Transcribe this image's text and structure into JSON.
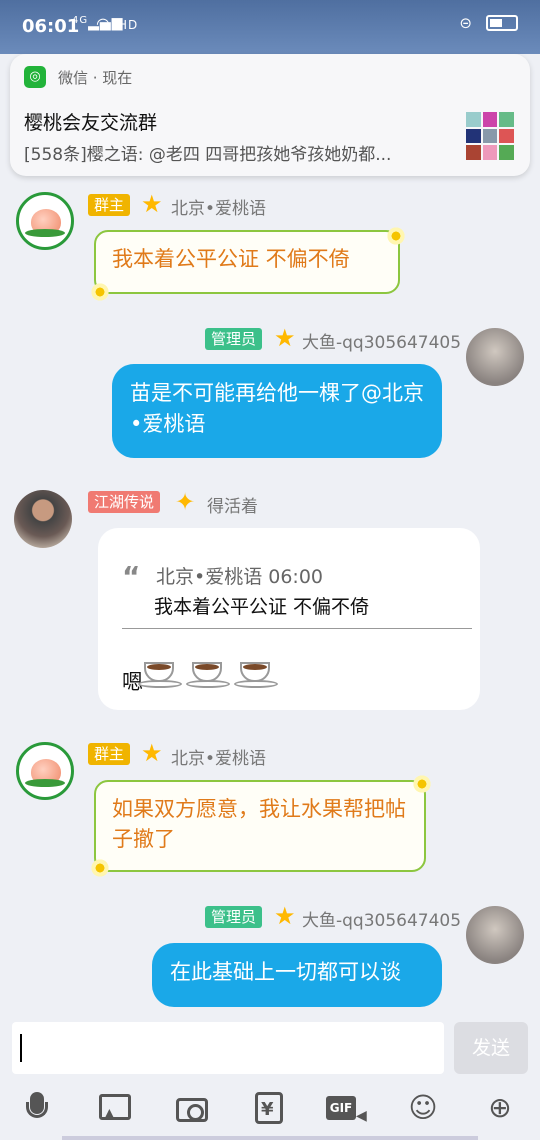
{
  "status_bar": {
    "time": "06:01",
    "signal": "4G",
    "network": "HD"
  },
  "notification": {
    "app_name": "微信 · 现在",
    "title": "樱桃会友交流群",
    "body": "[558条]樱之语: @老四 四哥把孩她爷孩她奶都..."
  },
  "messages": [
    {
      "badge": "群主",
      "sender": "北京•爱桃语",
      "text": "我本着公平公证  不偏不倚"
    },
    {
      "badge": "管理员",
      "sender": "大鱼-qq305647405",
      "text": "苗是不可能再给他一棵了@北京•爱桃语"
    },
    {
      "badge": "江湖传说",
      "sender": "得活着",
      "quote_meta": "北京•爱桃语 06:00",
      "quote_text": "我本着公平公证  不偏不倚",
      "reply": "嗯"
    },
    {
      "badge": "群主",
      "sender": "北京•爱桃语",
      "text": "如果双方愿意，我让水果帮把帖子撤了"
    },
    {
      "badge": "管理员",
      "sender": "大鱼-qq305647405",
      "text": "在此基础上一切都可以谈"
    }
  ],
  "input": {
    "send_label": "发送"
  },
  "toolbar": {
    "gif_label": "GIF",
    "money_label": "¥"
  },
  "colors": {
    "bubble_blue": "#1aa8e8",
    "owner_badge": "#f0b400",
    "admin_badge": "#3cc08a",
    "legend_badge": "#f07a72",
    "owner_text": "#e07a1a"
  }
}
